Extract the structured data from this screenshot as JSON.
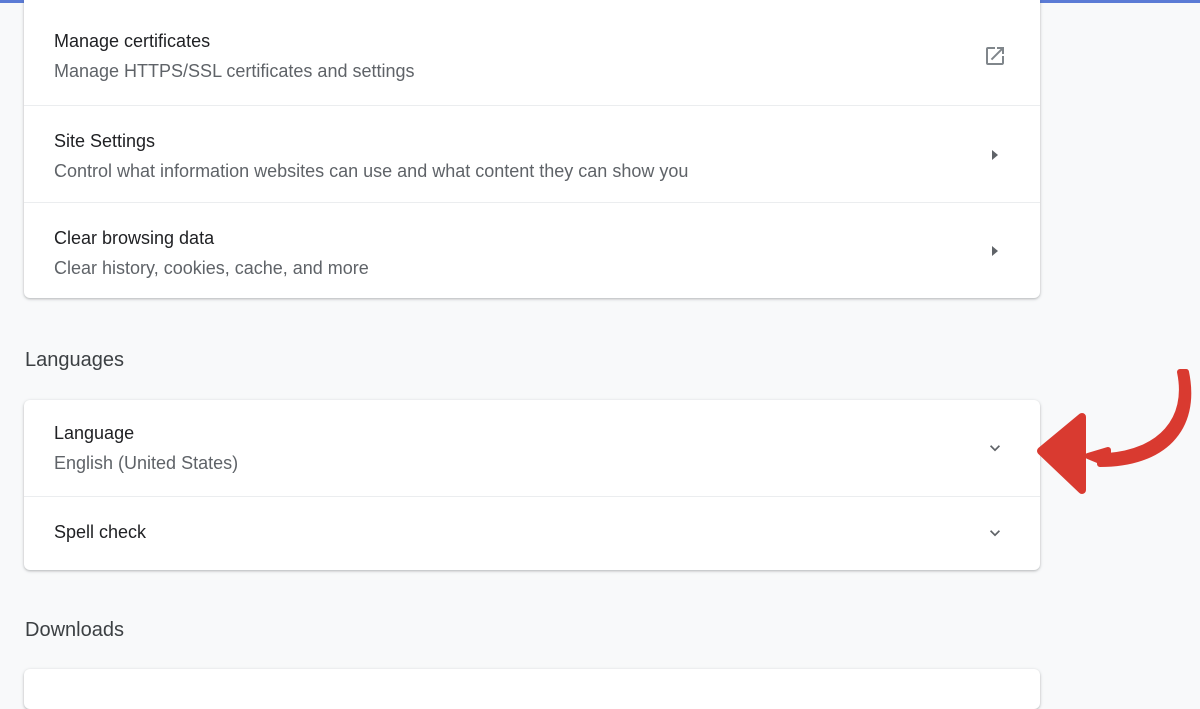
{
  "privacy": {
    "items": [
      {
        "title": "Manage certificates",
        "subtitle": "Manage HTTPS/SSL certificates and settings",
        "icon": "open-in-new-icon"
      },
      {
        "title": "Site Settings",
        "subtitle": "Control what information websites can use and what content they can show you",
        "icon": "chevron-right-icon"
      },
      {
        "title": "Clear browsing data",
        "subtitle": "Clear history, cookies, cache, and more",
        "icon": "chevron-right-icon"
      }
    ]
  },
  "languages": {
    "heading": "Languages",
    "items": [
      {
        "title": "Language",
        "subtitle": "English (United States)",
        "icon": "chevron-down-icon"
      },
      {
        "title": "Spell check",
        "icon": "chevron-down-icon"
      }
    ]
  },
  "downloads": {
    "heading": "Downloads"
  },
  "annotation": {
    "arrow_color": "#d93a30",
    "icon": "curved-arrow-icon"
  },
  "colors": {
    "page_background": "#f8f9fa",
    "card_background": "#ffffff",
    "top_accent": "#5b7bd5"
  }
}
